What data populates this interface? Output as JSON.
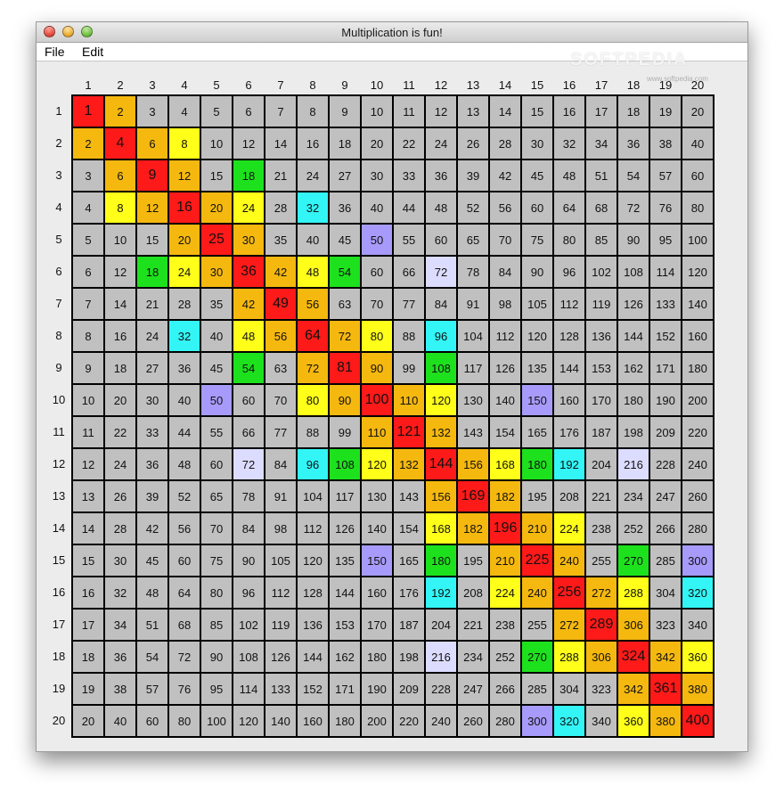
{
  "window": {
    "title": "Multiplication is fun!"
  },
  "menu": {
    "file": "File",
    "edit": "Edit"
  },
  "watermark": {
    "text": "SOFTPEDIA",
    "url": "www.softpedia.com"
  },
  "table": {
    "size": 20,
    "column_headers": [
      "1",
      "2",
      "3",
      "4",
      "5",
      "6",
      "7",
      "8",
      "9",
      "10",
      "11",
      "12",
      "13",
      "14",
      "15",
      "16",
      "17",
      "18",
      "19",
      "20"
    ],
    "row_headers": [
      "1",
      "2",
      "3",
      "4",
      "5",
      "6",
      "7",
      "8",
      "9",
      "10",
      "11",
      "12",
      "13",
      "14",
      "15",
      "16",
      "17",
      "18",
      "19",
      "20"
    ],
    "colors": {
      "square": "#ff1a1a",
      "d1": "#f5b80f",
      "d2": "#ffff1a",
      "d3": "#1ee11e",
      "d4": "#33f5f5",
      "d5": "#a69bfa",
      "d6": "#dcdcff",
      "other": "#c0c0c0"
    }
  }
}
